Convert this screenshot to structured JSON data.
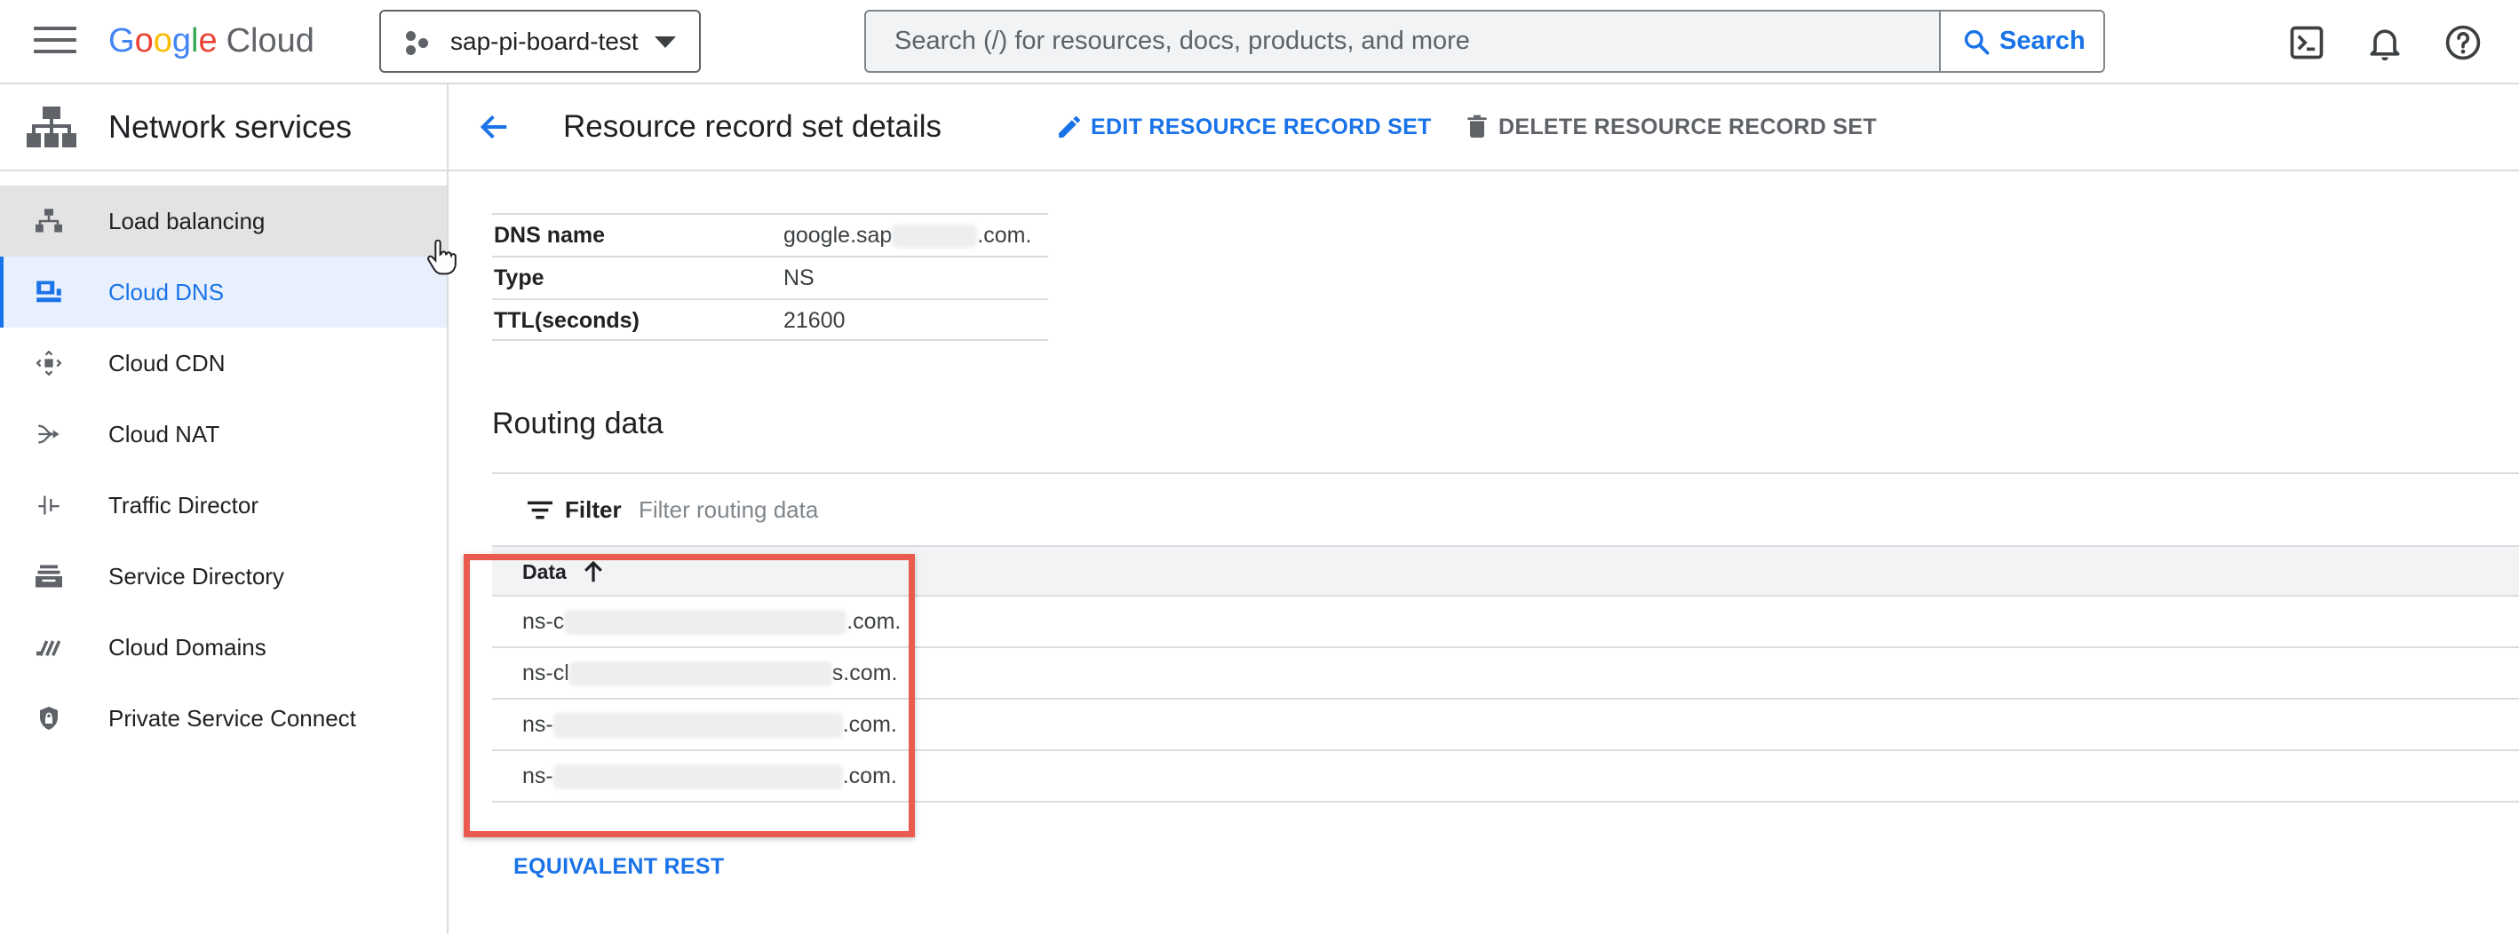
{
  "header": {
    "logo": {
      "google": [
        "G",
        "o",
        "o",
        "g",
        "l",
        "e"
      ],
      "cloud": "Cloud"
    },
    "project": {
      "name": "sap-pi-board-test"
    },
    "search": {
      "placeholder": "Search (/) for resources, docs, products, and more",
      "button_label": "Search"
    },
    "icons": [
      "cloud-shell-icon",
      "notifications-bell-icon",
      "help-icon"
    ]
  },
  "sidebar": {
    "title": "Network services",
    "items": [
      {
        "label": "Load balancing",
        "icon": "load-balancing-icon",
        "state": "hover"
      },
      {
        "label": "Cloud DNS",
        "icon": "cloud-dns-icon",
        "state": "active"
      },
      {
        "label": "Cloud CDN",
        "icon": "cloud-cdn-icon"
      },
      {
        "label": "Cloud NAT",
        "icon": "cloud-nat-icon"
      },
      {
        "label": "Traffic Director",
        "icon": "traffic-director-icon"
      },
      {
        "label": "Service Directory",
        "icon": "service-directory-icon"
      },
      {
        "label": "Cloud Domains",
        "icon": "cloud-domains-icon"
      },
      {
        "label": "Private Service Connect",
        "icon": "private-service-connect-icon"
      }
    ]
  },
  "page": {
    "title": "Resource record set details",
    "actions": {
      "edit": "EDIT RESOURCE RECORD SET",
      "delete": "DELETE RESOURCE RECORD SET"
    },
    "details": [
      {
        "key": "DNS name",
        "value_prefix": "google.sap",
        "value_suffix": ".com."
      },
      {
        "key": "Type",
        "value": "NS"
      },
      {
        "key": "TTL(seconds)",
        "value": "21600"
      }
    ],
    "routing": {
      "title": "Routing data",
      "filter_label": "Filter",
      "filter_placeholder": "Filter routing data",
      "column_header": "Data",
      "rows": [
        {
          "prefix": "ns-c",
          "suffix": ".com."
        },
        {
          "prefix": "ns-cl",
          "suffix": "s.com."
        },
        {
          "prefix": "ns-",
          "suffix": ".com."
        },
        {
          "prefix": "ns-",
          "suffix": ".com."
        }
      ]
    },
    "equivalent_rest": "EQUIVALENT REST"
  },
  "colors": {
    "accent": "#1a73e8",
    "highlight": "#ea5a4f",
    "active_bg": "#e8f0fe",
    "hover_bg": "#e3e3e3"
  }
}
